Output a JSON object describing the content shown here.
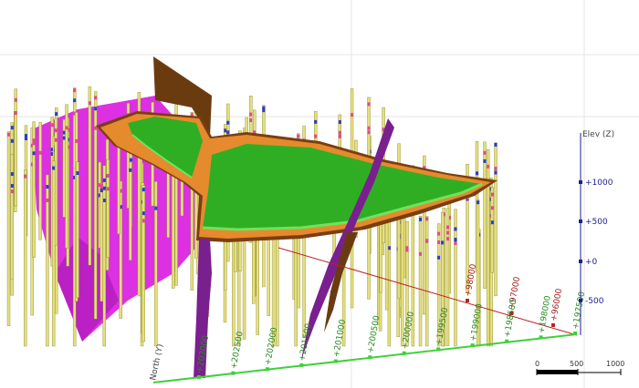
{
  "viewer": {
    "background": "#ffffff",
    "colors": {
      "borehole": "#e5df7d",
      "borehole_edge": "#8b8830",
      "magenta_fault": "#d91ee0",
      "purple_fault": "#7a1f8e",
      "brown_fault": "#6b3b10",
      "surface_green": "#2fae23",
      "surface_green_light": "#6fe25c",
      "surface_orange": "#e58a2d",
      "surface_brown": "#7a3e12",
      "red_axis": "#b92424",
      "green_axis": "#3fd13a",
      "elev_axis": "#1a1f8f"
    }
  },
  "elevation_axis": {
    "title": "Elev (Z)",
    "ticks": [
      "+1000",
      "+500",
      "+0",
      "-500"
    ]
  },
  "north_axis": {
    "title": "North (Y)",
    "ticks": [
      "+203000",
      "+202500",
      "+202000",
      "+201500",
      "+201000",
      "+200500",
      "+200000",
      "+199500",
      "+199000",
      "+198500",
      "+198000",
      "+197500"
    ]
  },
  "east_axis": {
    "ticks": [
      "+98000",
      "+97000",
      "+96000"
    ]
  },
  "scale_bar": {
    "labels": [
      "0",
      "500",
      "1000"
    ]
  }
}
